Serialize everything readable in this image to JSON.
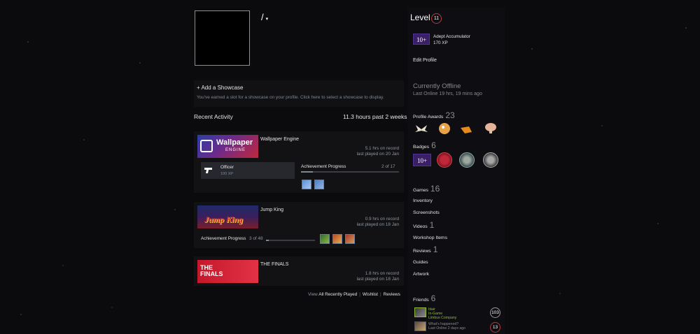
{
  "profile": {
    "name": "/",
    "caret": "▾"
  },
  "showcase": {
    "title": "+ Add a Showcase",
    "desc": "You've earned a slot for a showcase on your profile. Click here to select a showcase to display."
  },
  "recent_activity": {
    "title": "Recent Activity",
    "hours": "11.3 hours past 2 weeks"
  },
  "games": [
    {
      "name": "Wallpaper Engine",
      "capsule_text": "Wallpaper",
      "capsule_sub": "ENGINE",
      "hours": "5.1 hrs on record",
      "last_played": "last played on 20 Jan",
      "achievement": {
        "name": "Officer",
        "xp": "100 XP",
        "label": "Achievement Progress",
        "count": "2 of 17",
        "progress": 0.12
      }
    },
    {
      "name": "Jump King",
      "capsule_text": "Jump King",
      "hours": "0.9 hrs on record",
      "last_played": "last played on 18 Jan",
      "achievement": {
        "label": "Achievement Progress",
        "count": "3 of 48",
        "progress": 0.06
      }
    },
    {
      "name": "THE FINALS",
      "capsule_text": "THE FINALS",
      "hours": "1.8 hrs on record",
      "last_played": "last played on 18 Jan"
    }
  ],
  "footer": {
    "view": "View",
    "all": "All Recently Played",
    "wishlist": "Wishlist",
    "reviews": "Reviews",
    "sep": "|"
  },
  "sidebar": {
    "level_label": "Level",
    "level": "11",
    "xp_badge": "10+",
    "xp_badge_name": "Adept Accumulator",
    "xp_badge_xp": "170 XP",
    "edit_profile": "Edit Profile",
    "status": "Currently Offline",
    "last_online": "Last Online 19 hrs, 19 mins ago",
    "awards_label": "Profile Awards",
    "awards_count": "23",
    "badges_label": "Badges",
    "badges_count": "6",
    "badge_text": "10+",
    "links": [
      {
        "label": "Games",
        "count": "16"
      },
      {
        "label": "Inventory",
        "count": ""
      },
      {
        "label": "Screenshots",
        "count": ""
      },
      {
        "label": "Videos",
        "count": "1"
      },
      {
        "label": "Workshop Items",
        "count": ""
      },
      {
        "label": "Reviews",
        "count": "1"
      },
      {
        "label": "Guides",
        "count": ""
      },
      {
        "label": "Artwork",
        "count": ""
      }
    ],
    "friends_label": "Friends",
    "friends_count": "6",
    "friends": [
      {
        "name": "blair",
        "status": "In-Game",
        "game": "Limbus Company",
        "level": "103"
      },
      {
        "name": "What's happened?",
        "status": "Last Online 2 days ago",
        "level": "13"
      }
    ]
  },
  "colors": {
    "accent_red": "#b53a3a",
    "ingame_green": "#8fb93b",
    "xp_purple": "#3a1f66"
  }
}
